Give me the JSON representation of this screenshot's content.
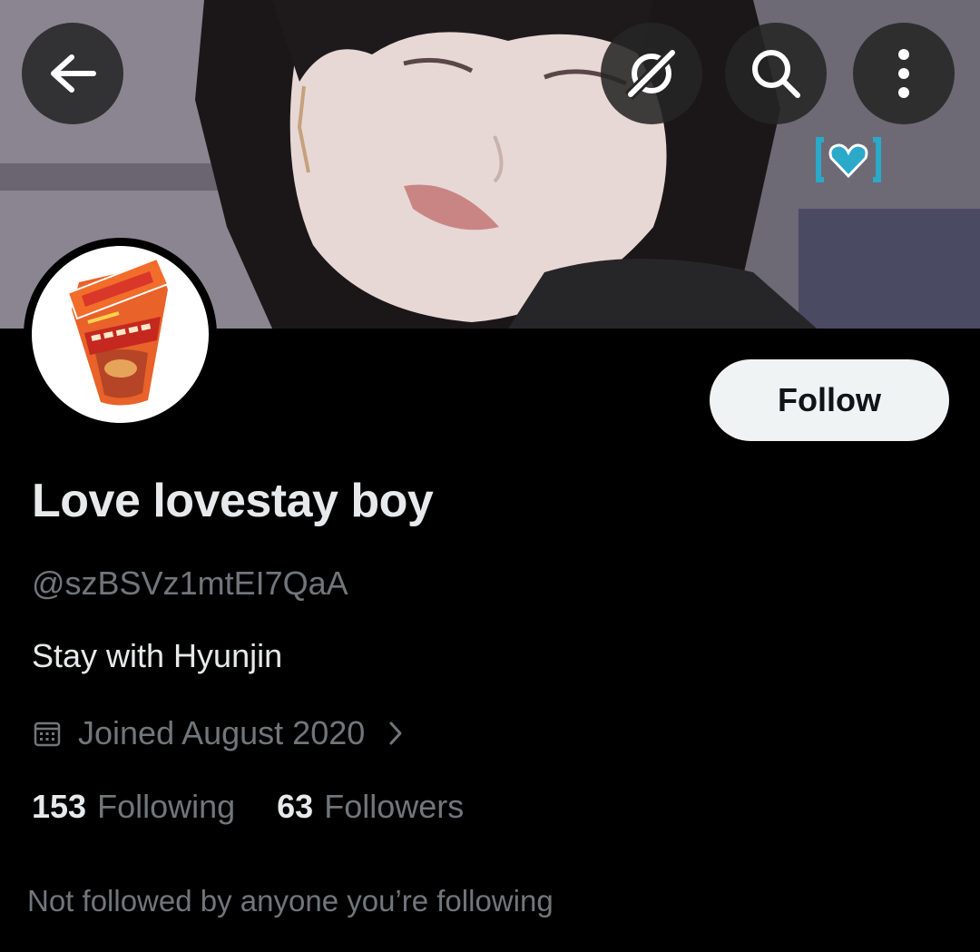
{
  "header": {
    "back_icon": "arrow-left-icon",
    "grok_icon": "grok-icon",
    "search_icon": "search-icon",
    "more_icon": "more-vertical-icon"
  },
  "banner": {
    "sticker_icon": "heart-sticker-icon"
  },
  "profile": {
    "display_name": "Love lovestay boy",
    "handle": "@szBSVz1mtEI7QaA",
    "bio": "Stay with Hyunjin",
    "joined": "Joined August 2020",
    "joined_icon": "calendar-icon",
    "following_count": "153",
    "following_label": "Following",
    "followers_count": "63",
    "followers_label": "Followers",
    "mutuals_text": "Not followed by anyone you’re following"
  },
  "actions": {
    "follow_label": "Follow"
  },
  "colors": {
    "background": "#000000",
    "primary_text": "#e7e9ea",
    "secondary_text": "#71767b",
    "follow_button_bg": "#eff3f4",
    "follow_button_text": "#0f1419",
    "icon_button_bg": "#262626",
    "sticker_accent": "#2aa9c9"
  }
}
